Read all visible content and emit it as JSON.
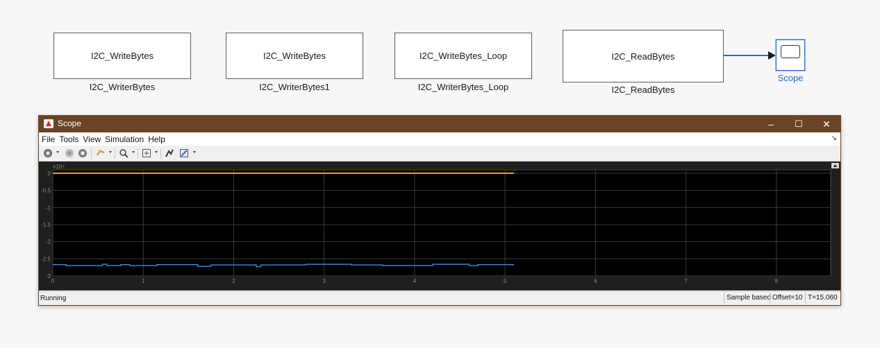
{
  "model": {
    "blocks": [
      {
        "label": "I2C_WriteBytes",
        "caption": "I2C_WriterBytes"
      },
      {
        "label": "I2C_WriteBytes",
        "caption": "I2C_WriterBytes1"
      },
      {
        "label": "I2C_WriteBytes_Loop",
        "caption": "I2C_WriterBytes_Loop"
      },
      {
        "label": "I2C_ReadBytes",
        "caption": "I2C_ReadBytes"
      }
    ],
    "scope_caption": "Scope",
    "signal_color": "#1b6dd0"
  },
  "window": {
    "title": "Scope",
    "controls": {
      "minimize": "–",
      "maximize": "☐",
      "close": "✕"
    },
    "titlebar_color": "#6b4425",
    "menus": [
      "File",
      "Tools",
      "View",
      "Simulation",
      "Help"
    ],
    "toolbar_icons": [
      "settings-icon",
      "step-back-icon",
      "stop-icon",
      "highlight-icon",
      "zoom-icon",
      "fit-to-view-icon",
      "triggers-icon",
      "edit-style-icon"
    ]
  },
  "status": {
    "left": "Running",
    "sample_mode": "Sample based",
    "offset": "Offset=10",
    "time": "T=15.060"
  },
  "chart_data": {
    "type": "line",
    "background": "#000000",
    "grid": true,
    "exponent_label": "×10⁴",
    "xlim": [
      0,
      8.6
    ],
    "ylim": [
      -3,
      0.1
    ],
    "x_ticks": [
      "0",
      "1",
      "2",
      "3",
      "4",
      "5",
      "6",
      "7",
      "8"
    ],
    "y_ticks": [
      "0",
      "-0.5",
      "-1",
      "-1.5",
      "-2",
      "-2.5",
      "-3"
    ],
    "series": [
      {
        "color": "#e8a33a",
        "x": [
          0,
          5.1
        ],
        "y": [
          0,
          0
        ]
      },
      {
        "color": "#3a8fe0",
        "x": [
          0,
          0.15,
          0.15,
          0.55,
          0.55,
          0.6,
          0.6,
          0.75,
          0.75,
          0.85,
          0.85,
          1.15,
          1.15,
          1.6,
          1.6,
          1.75,
          1.75,
          2.25,
          2.25,
          2.3,
          2.3,
          2.8,
          2.8,
          3.3,
          3.3,
          3.65,
          3.65,
          4.2,
          4.2,
          4.6,
          4.6,
          4.7,
          4.7,
          5.1
        ],
        "y": [
          -2.67,
          -2.67,
          -2.7,
          -2.7,
          -2.66,
          -2.66,
          -2.7,
          -2.7,
          -2.67,
          -2.67,
          -2.7,
          -2.7,
          -2.67,
          -2.67,
          -2.72,
          -2.72,
          -2.68,
          -2.68,
          -2.73,
          -2.73,
          -2.68,
          -2.68,
          -2.66,
          -2.66,
          -2.68,
          -2.68,
          -2.7,
          -2.7,
          -2.66,
          -2.66,
          -2.7,
          -2.7,
          -2.67,
          -2.67
        ]
      }
    ]
  }
}
